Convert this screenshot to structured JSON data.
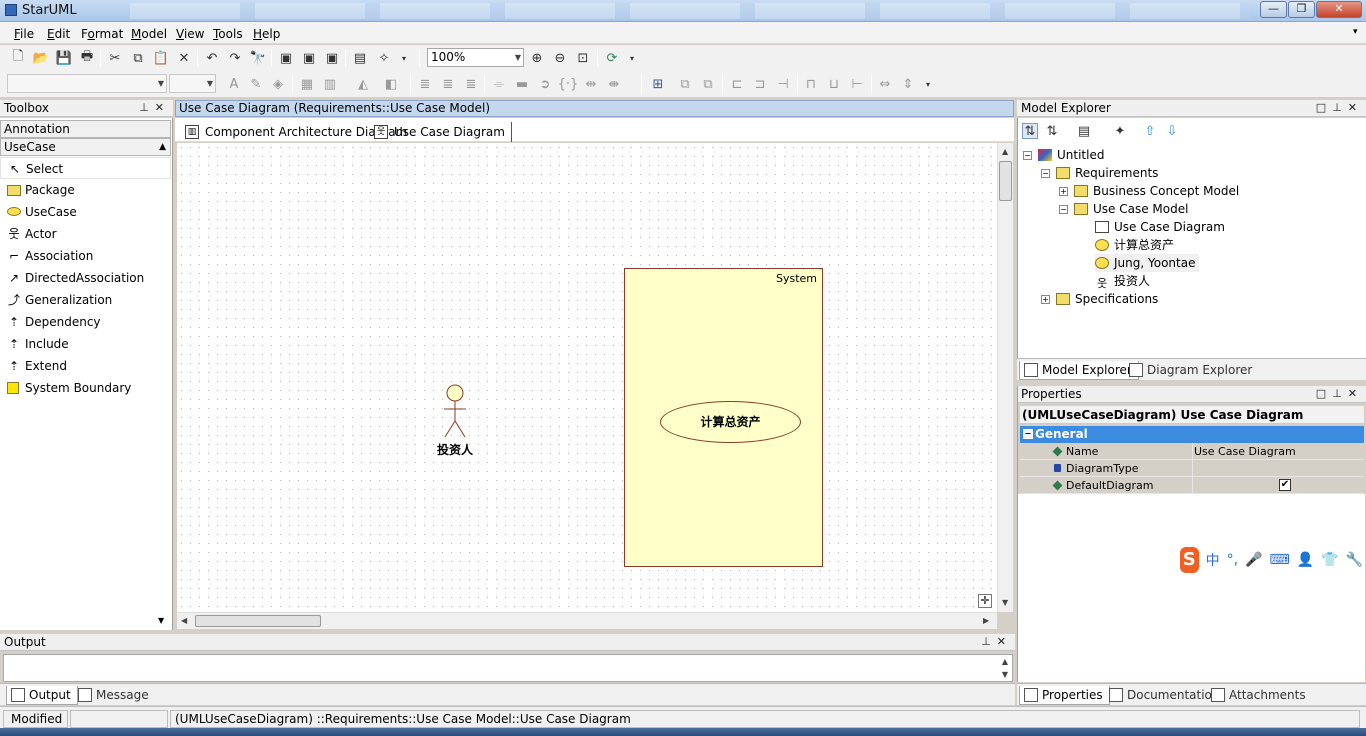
{
  "window": {
    "title": "StarUML",
    "controls": [
      "—",
      "❐",
      "✕"
    ]
  },
  "menu": [
    {
      "label": "File",
      "key": "F"
    },
    {
      "label": "Edit",
      "key": "E"
    },
    {
      "label": "Format",
      "key": "o"
    },
    {
      "label": "Model",
      "key": "M"
    },
    {
      "label": "View",
      "key": "V"
    },
    {
      "label": "Tools",
      "key": "T"
    },
    {
      "label": "Help",
      "key": "H"
    }
  ],
  "toolbar": {
    "zoom_value": "100%",
    "icons": [
      "new-icon",
      "open-icon",
      "save-icon",
      "print-icon",
      "cut-icon",
      "copy-icon",
      "paste-icon",
      "delete-icon",
      "undo-icon",
      "redo-icon",
      "find-icon",
      "zoom-in-icon",
      "zoom-out-icon",
      "fit-icon",
      "refresh-icon"
    ]
  },
  "toolbox": {
    "title": "Toolbox",
    "sections": [
      "Annotation",
      "UseCase"
    ],
    "items": [
      {
        "label": "Select",
        "icon": "cursor-icon",
        "glyph": "↖"
      },
      {
        "label": "Package",
        "icon": "package-icon",
        "glyph": ""
      },
      {
        "label": "UseCase",
        "icon": "usecase-icon",
        "glyph": ""
      },
      {
        "label": "Actor",
        "icon": "actor-icon",
        "glyph": "웃"
      },
      {
        "label": "Association",
        "icon": "association-icon",
        "glyph": "⌐"
      },
      {
        "label": "DirectedAssociation",
        "icon": "directed-association-icon",
        "glyph": "↗"
      },
      {
        "label": "Generalization",
        "icon": "generalization-icon",
        "glyph": "⤴"
      },
      {
        "label": "Dependency",
        "icon": "dependency-icon",
        "glyph": "⇡"
      },
      {
        "label": "Include",
        "icon": "include-icon",
        "glyph": "⇡"
      },
      {
        "label": "Extend",
        "icon": "extend-icon",
        "glyph": "⇡"
      },
      {
        "label": "System Boundary",
        "icon": "system-boundary-icon",
        "glyph": ""
      }
    ]
  },
  "diagram": {
    "header": "Use Case Diagram (Requirements::Use Case Model)",
    "tabs": [
      "Component Architecture Diagram",
      "Use Case Diagram"
    ],
    "system_label": "System",
    "usecase_label": "计算总资产",
    "actor_label": "投资人"
  },
  "model_explorer": {
    "title": "Model Explorer",
    "tree": [
      {
        "label": "Untitled",
        "expander": "−"
      },
      {
        "label": "Requirements",
        "expander": "−"
      },
      {
        "label": "Business Concept Model",
        "expander": "+"
      },
      {
        "label": "Use Case Model",
        "expander": "−"
      },
      {
        "label": "Use Case Diagram",
        "expander": ""
      },
      {
        "label": "计算总资产",
        "expander": ""
      },
      {
        "label": "Jung, Yoontae",
        "expander": ""
      },
      {
        "label": "投资人",
        "expander": ""
      },
      {
        "label": "Specifications",
        "expander": "+"
      }
    ],
    "tabs": [
      "Model Explorer",
      "Diagram Explorer"
    ]
  },
  "properties": {
    "title": "Properties",
    "selected": "(UMLUseCaseDiagram) Use Case Diagram",
    "category": "General",
    "rows": [
      {
        "name": "Name",
        "value": "Use Case Diagram"
      },
      {
        "name": "DiagramType",
        "value": ""
      },
      {
        "name": "DefaultDiagram",
        "value": "✔"
      }
    ],
    "tabs": [
      "Properties",
      "Documentation",
      "Attachments"
    ]
  },
  "ime": {
    "logo": "S",
    "items": [
      "中",
      "°,",
      "🎤",
      "⌨",
      "👤",
      "👕",
      "🔧"
    ]
  },
  "output": {
    "title": "Output",
    "tabs": [
      "Output",
      "Message"
    ]
  },
  "status": {
    "state": "Modified",
    "blank": "",
    "path": "(UMLUseCaseDiagram) ::Requirements::Use Case Model::Use Case Diagram"
  },
  "colors": {
    "diagram_fill": "#ffffc8",
    "diagram_stroke": "#8b3a2a",
    "selection_blue": "#3b8be0",
    "header_blue": "#c3d7ef"
  }
}
